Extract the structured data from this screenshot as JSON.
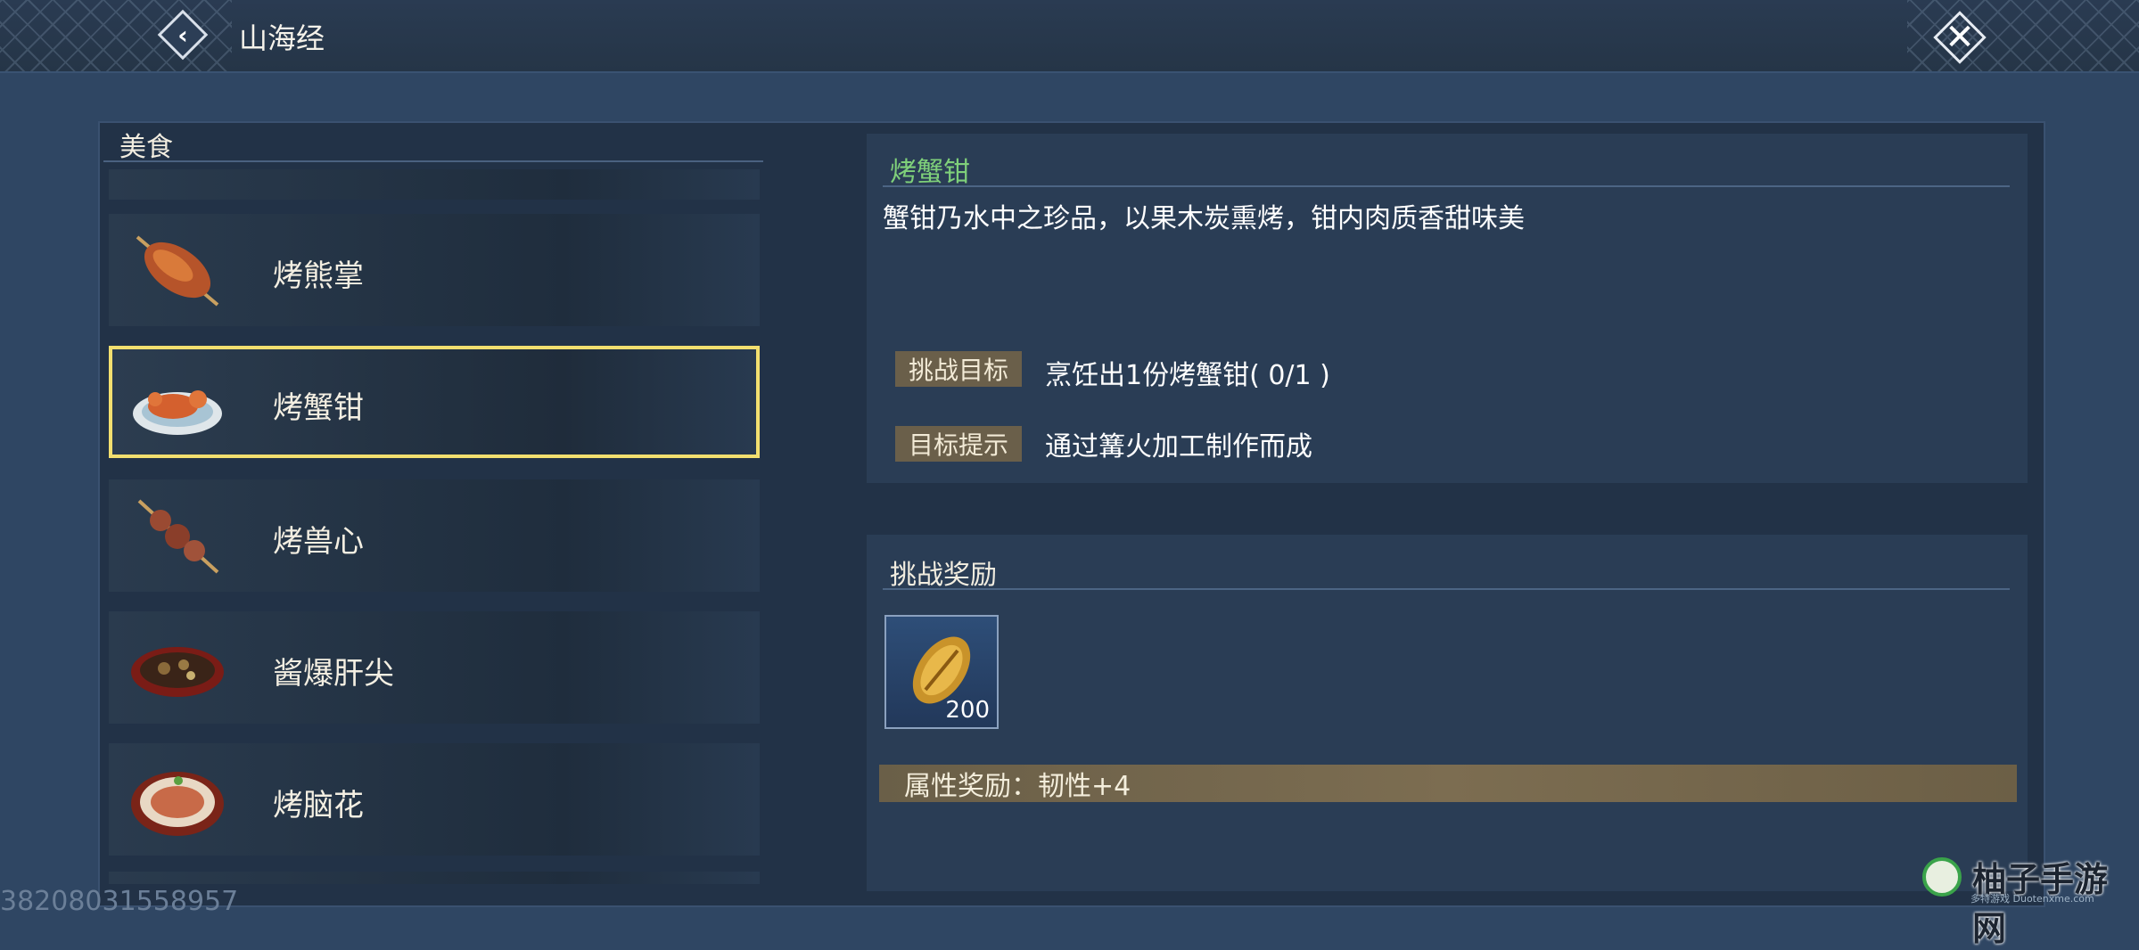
{
  "header": {
    "title": "山海经",
    "back_icon": "back-chevron-icon",
    "close_icon": "close-x-icon"
  },
  "list": {
    "section_label": "美食",
    "items": [
      {
        "label": "烤熊掌",
        "icon": "bear-paw-skewer-icon",
        "selected": false
      },
      {
        "label": "烤蟹钳",
        "icon": "crab-claw-plate-icon",
        "selected": true
      },
      {
        "label": "烤兽心",
        "icon": "heart-skewer-icon",
        "selected": false
      },
      {
        "label": "酱爆肝尖",
        "icon": "liver-dish-icon",
        "selected": false
      },
      {
        "label": "烤脑花",
        "icon": "brain-bowl-icon",
        "selected": false
      }
    ]
  },
  "detail": {
    "title": "烤蟹钳",
    "description": "蟹钳乃水中之珍品，以果木炭熏烤，钳内肉质香甜味美",
    "challenge_tag": "挑战目标",
    "challenge_text": "烹饪出1份烤蟹钳( 0/1 )",
    "hint_tag": "目标提示",
    "hint_text": "通过篝火加工制作而成"
  },
  "reward": {
    "title": "挑战奖励",
    "item_icon": "golden-shell-icon",
    "item_count": "200",
    "attribute_text": "属性奖励：韧性+4"
  },
  "footer": {
    "id_text": "38208031558957"
  },
  "watermark": {
    "text": "柚子手游网",
    "subtext": "多特游戏 Duotenxme.com"
  },
  "colors": {
    "selected_border": "#f2df6f",
    "title_green": "#7fd07a",
    "tag_bg": "#6a5f4a"
  }
}
